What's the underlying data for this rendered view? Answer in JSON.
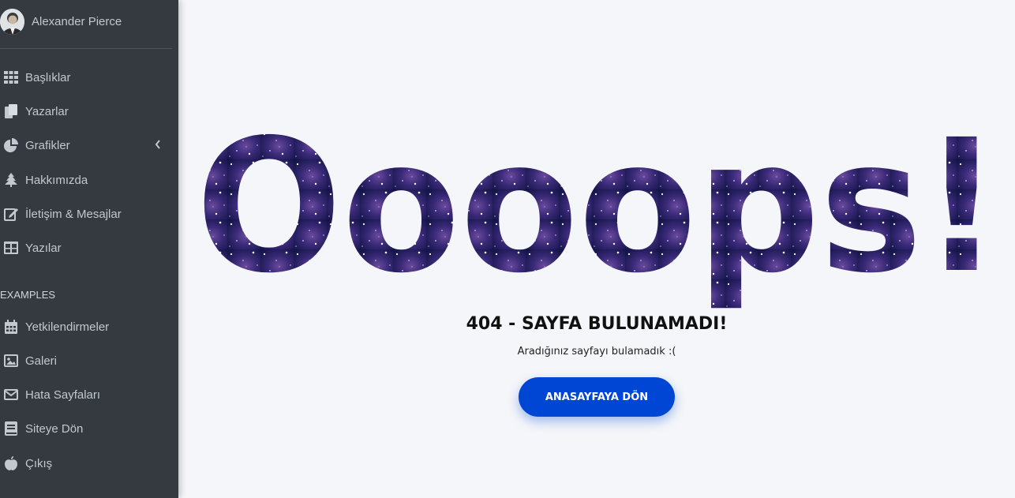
{
  "user": {
    "name": "Alexander Pierce",
    "avatar_icon": "user-avatar"
  },
  "nav": {
    "items": [
      {
        "label": "Başlıklar",
        "icon": "grid-icon"
      },
      {
        "label": "Yazarlar",
        "icon": "copy-icon"
      },
      {
        "label": "Grafikler",
        "icon": "pie-chart-icon"
      },
      {
        "label": "Hakkımızda",
        "icon": "tree-icon"
      },
      {
        "label": "İletişim & Mesajlar",
        "icon": "edit-icon"
      },
      {
        "label": "Yazılar",
        "icon": "table-icon"
      }
    ],
    "section_header": "EXAMPLES",
    "examples": [
      {
        "label": "Yetkilendirmeler",
        "icon": "calendar-icon"
      },
      {
        "label": "Galeri",
        "icon": "image-icon"
      },
      {
        "label": "Hata Sayfaları",
        "icon": "envelope-icon"
      },
      {
        "label": "Siteye Dön",
        "icon": "book-icon"
      },
      {
        "label": "Çıkış",
        "icon": "apple-icon"
      }
    ]
  },
  "error": {
    "oops_text": "Oooops!",
    "title": "404 - SAYFA BULUNAMADI!",
    "message": "Aradığınız sayfayı bulamadık :(",
    "button_label": "ANASAYFAYA DÖN"
  },
  "colors": {
    "sidebar_bg": "#343a40",
    "sidebar_text": "#c2c7d0",
    "page_bg": "#f4f6f9",
    "button_bg": "#0046d5"
  }
}
